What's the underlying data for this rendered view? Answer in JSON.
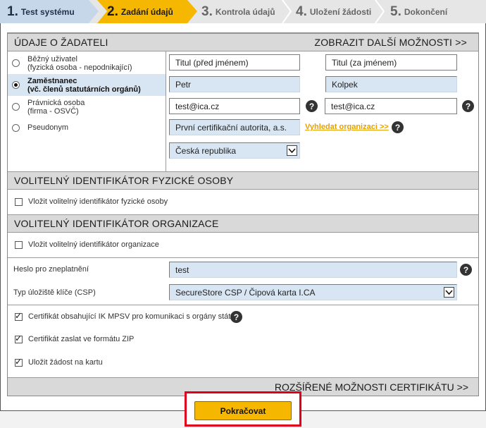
{
  "steps": [
    {
      "num": "1.",
      "label": "Test systému"
    },
    {
      "num": "2.",
      "label": "Zadání údajů"
    },
    {
      "num": "3.",
      "label": "Kontrola údajů"
    },
    {
      "num": "4.",
      "label": "Uložení žádosti"
    },
    {
      "num": "5.",
      "label": "Dokončení"
    }
  ],
  "applicant": {
    "heading": "ÚDAJE O ŽADATELI",
    "more_options": "ZOBRAZIT DALŠÍ MOŽNOSTI >>",
    "types": [
      {
        "line1": "Běžný uživatel",
        "line2": "(fyzická osoba - nepodnikající)"
      },
      {
        "line1": "Zaměstnanec",
        "line2": "(vč. členů statutárních orgánů)"
      },
      {
        "line1": "Právnická osoba",
        "line2": "(firma - OSVČ)"
      },
      {
        "line1": "Pseudonym",
        "line2": ""
      }
    ],
    "selected_type": "Zaměstnanec",
    "title_before": "Titul (před jménem)",
    "title_after": "Titul (za jménem)",
    "first_name": "Petr",
    "last_name": "Kolpek",
    "email": "test@ica.cz",
    "email_confirm": "test@ica.cz",
    "organization": "První certifikační autorita, a.s.",
    "find_org_link": "Vyhledat organizaci >>",
    "country": "Česká republika"
  },
  "person_id": {
    "heading": "VOLITELNÝ IDENTIFIKÁTOR FYZICKÉ OSOBY",
    "checkbox_label": "Vložit volitelný identifikátor fyzické osoby",
    "checked": false
  },
  "org_id": {
    "heading": "VOLITELNÝ IDENTIFIKÁTOR ORGANIZACE",
    "checkbox_label": "Vložit volitelný identifikátor organizace",
    "checked": false
  },
  "revocation": {
    "label": "Heslo pro zneplatnění",
    "value": "test"
  },
  "csp": {
    "label": "Typ úložiště klíče (CSP)",
    "value": "SecureStore CSP / Čipová karta I.CA"
  },
  "options": [
    {
      "label": "Certifikát obsahující IK MPSV pro komunikaci s orgány státu",
      "checked": true,
      "help": true
    },
    {
      "label": "Certifikát zaslat ve formátu ZIP",
      "checked": true,
      "help": false
    },
    {
      "label": "Uložit žádost na kartu",
      "checked": true,
      "help": false
    }
  ],
  "advanced_options": "ROZŠÍŘENÉ MOŽNOSTI CERTIFIKÁTU >>",
  "continue_button": "Pokračovat",
  "help_glyph": "?",
  "colors": {
    "active_step": "#f6b700",
    "done_step": "#c7d7ea",
    "field_blue": "#d8e5f3",
    "highlight_frame": "#e0001b"
  }
}
